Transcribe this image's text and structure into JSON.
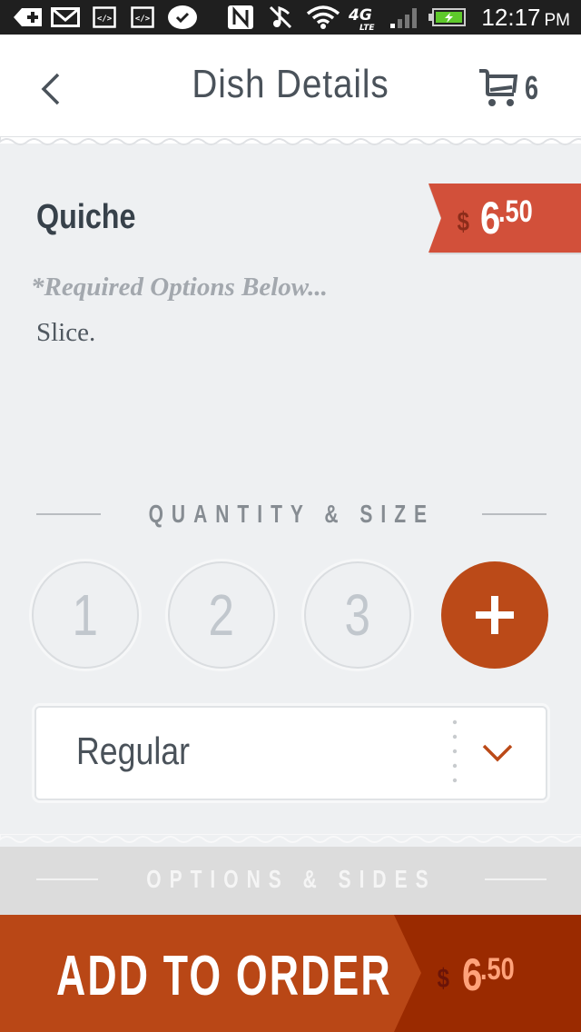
{
  "status_bar": {
    "time": "12:17",
    "ampm": "PM",
    "icons": [
      "add-tag-icon",
      "gmail-icon",
      "code-icon",
      "code-icon",
      "check-bubble-icon",
      "nfc-icon",
      "mute-icon",
      "wifi-icon",
      "4g-lte-icon",
      "signal-icon",
      "battery-charging-icon"
    ],
    "network_label": "4G",
    "network_sub": "LTE"
  },
  "header": {
    "title": "Dish Details",
    "back_icon": "chevron-left-icon",
    "cart_icon": "cart-icon",
    "cart_count": "6"
  },
  "dish": {
    "name": "Quiche",
    "price": {
      "currency": "$",
      "main": "6",
      "cents": ".50"
    },
    "required_note": "*Required Options Below...",
    "description": "Slice."
  },
  "quantity_section": {
    "heading": "QUANTITY & SIZE",
    "options": [
      "1",
      "2",
      "3"
    ],
    "add_icon": "plus-icon"
  },
  "size_select": {
    "value": "Regular",
    "icon": "chevron-down-icon"
  },
  "options_section": {
    "heading": "OPTIONS & SIDES"
  },
  "order_bar": {
    "label": "ADD TO ORDER",
    "price": {
      "currency": "$",
      "main": "6",
      "cents": ".50"
    }
  },
  "colors": {
    "accent": "#bb4a18",
    "price_tag": "#d2503a",
    "order_bar": "#b94716",
    "order_price_bg": "#9a2a00",
    "text_dark": "#37414a",
    "background": "#eef0f2"
  }
}
